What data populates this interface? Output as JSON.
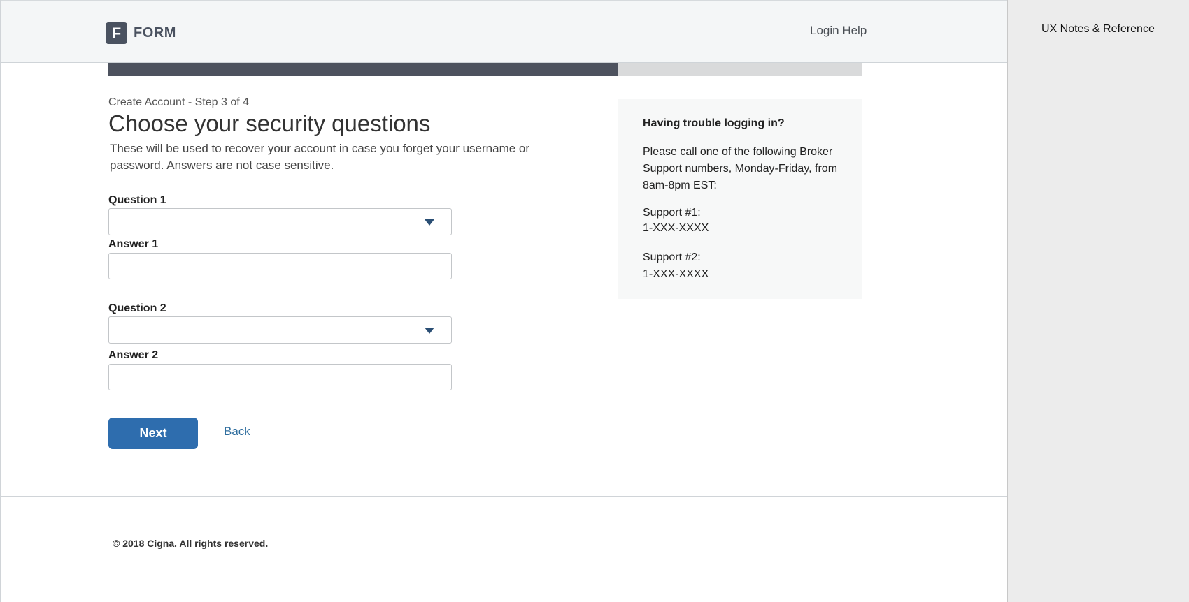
{
  "header": {
    "logo_letter": "F",
    "logo_text": "FORM",
    "login_help": "Login Help"
  },
  "progress": {
    "fraction": 0.675
  },
  "form": {
    "step": "Create Account - Step 3 of 4",
    "title": "Choose your security questions",
    "description": "These will be used to recover your account in case you forget your username or password. Answers are not case sensitive.",
    "question1_label": "Question 1",
    "question1_value": "",
    "answer1_label": "Answer 1",
    "answer1_value": "",
    "question2_label": "Question 2",
    "question2_value": "",
    "answer2_label": "Answer 2",
    "answer2_value": "",
    "next_label": "Next",
    "back_label": "Back"
  },
  "help": {
    "title": "Having trouble logging in?",
    "body": "Please call one of the following Broker Support numbers, Monday-Friday, from 8am-8pm EST:",
    "support1_label": "Support #1:",
    "support1_number": "1-XXX-XXXX",
    "support2_label": "Support #2:",
    "support2_number": "1-XXX-XXXX"
  },
  "footer": {
    "copyright": "© 2018 Cigna. All rights reserved."
  },
  "side_panel": {
    "title": "UX Notes & Reference"
  },
  "colors": {
    "primary_button": "#2e6dae",
    "progress_fill": "#4d525e",
    "progress_track": "#d9dadb",
    "link": "#2e6d9e"
  }
}
